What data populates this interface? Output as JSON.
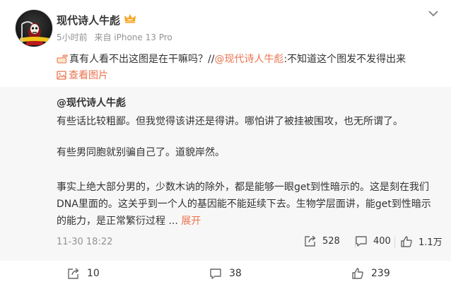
{
  "post": {
    "author": "现代诗人牛彪",
    "time": "5小时前",
    "source": "来自 iPhone 13 Pro",
    "text_main": "真有人看不出这图是在干嘛吗？//",
    "mention": "@现代诗人牛彪",
    "text_tail": ":不知道这个图发不发得出来",
    "view_pic_label": "查看图片",
    "icons": {
      "avatar": "avatar-grim-reaper",
      "badge": "crown-icon",
      "menu": "chevron-down-icon",
      "pointing": "pointing-finger-icon",
      "picture": "image-icon"
    }
  },
  "repost": {
    "author": "@现代诗人牛彪",
    "lines": [
      "有些话比较粗鄙。但我觉得该讲还是得讲。哪怕讲了被挂被围攻，也无所谓了。",
      "有些男同胞就别骗自己了。道貌岸然。",
      "事实上绝大部分男的，少数木讷的除外，都是能够一眼get到性暗示的。这是刻在我们",
      "DNA里面的。这关乎到一个人的基因能不能延续下去。生物学层面讲，能get到性暗示",
      "的能力，是正常繁衍过程"
    ],
    "ellipsis": " ... ",
    "expand_label": "展开",
    "date": "11-30 18:22",
    "reposts": "528",
    "comments": "400",
    "likes": "1.1万"
  },
  "footer": {
    "reposts": "10",
    "comments": "38",
    "likes": "239"
  },
  "colors": {
    "accent": "#eb7350",
    "text": "#333333",
    "muted": "#939393",
    "repost_bg": "#f7f7f7"
  }
}
